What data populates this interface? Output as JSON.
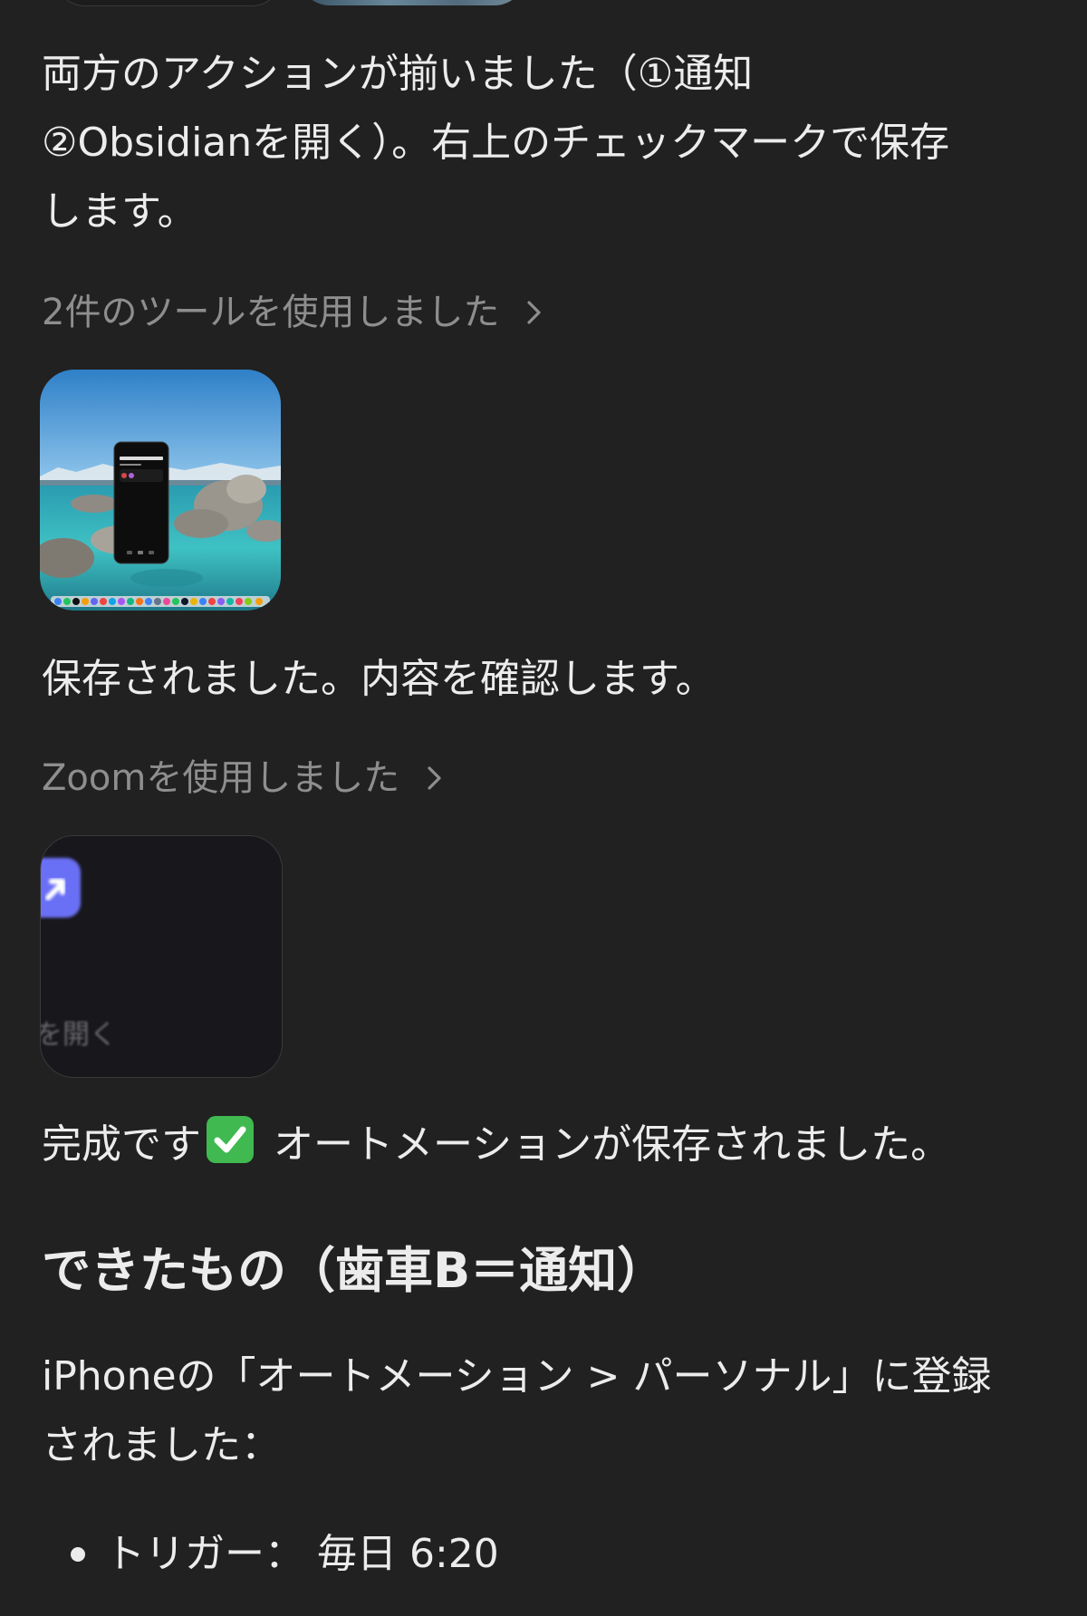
{
  "messages": {
    "p1_line1": "両方のアクションが揃いました（①通知",
    "p1_line2": "②Obsidianを開く）。右上のチェックマークで保存",
    "p1_line3": "します。",
    "tool1_label": "2件のツールを使用しました",
    "p2": "保存されました。内容を確認します。",
    "tool2_label": "Zoomを使用しました",
    "zoom_thumb_text": "を開く",
    "p3_before": "完成です",
    "p3_after": " オートメーションが保存されました。",
    "heading": "できたもの（歯車B＝通知）",
    "p4_line1": "iPhoneの「オートメーション > パーソナル」に登録",
    "p4_line2": "されました：",
    "bullets": [
      {
        "label": "トリガー： 毎日 6:20"
      }
    ]
  },
  "thumb1_phone": {
    "title": "オートメーション"
  },
  "icons": {
    "chevron": "chevron-right-icon",
    "check": "white-check-mark-icon",
    "arrow": "arrow-up-right-icon"
  },
  "colors": {
    "background": "#212121",
    "text": "#ececec",
    "muted": "#8e8e8e",
    "check_green": "#3fb950",
    "accent_blue": "#6b6ff5"
  }
}
